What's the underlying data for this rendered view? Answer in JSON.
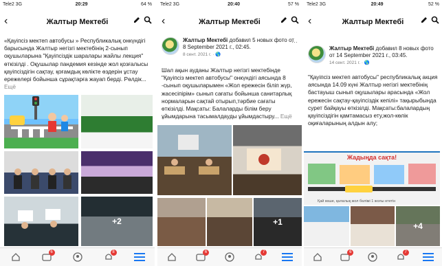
{
  "colors": {
    "accent": "#1877f2",
    "badge": "#e53935",
    "tabbar": "#f7f7f7"
  },
  "screens": [
    {
      "status": {
        "carrier": "Tele2 3G",
        "time": "20:29",
        "battery": "64 %"
      },
      "title": "Жалтыр Мектебі",
      "post_text": "«Қауіпсіз мектеп автобусы » Республикалық онкүндігі барысында Жалтыр негізгі мектебінің 2-сынып оқушыларына \"Қауіпсіздік шаралары жайлы лекция\" өткізілді . Оқушылар пандемия кезінде жол қозғалысы қауіпсіздігін сақтау, қоғамдық көлікте өздерін ұстау ережелері бойынша сұрақтарға жауап берді. Рөлдік...",
      "more": "Ещё",
      "photo_overlay": "+2",
      "tabs": [
        {
          "icon": "home-icon",
          "badge": ""
        },
        {
          "icon": "video-icon",
          "badge": "6"
        },
        {
          "icon": "profile-icon",
          "badge": ""
        },
        {
          "icon": "bell-icon",
          "badge": "8"
        },
        {
          "icon": "menu-icon",
          "badge": ""
        }
      ]
    },
    {
      "status": {
        "carrier": "Tele2 3G",
        "time": "20:40",
        "battery": "57 %"
      },
      "title": "Жалтыр Мектебі",
      "author": "Жалтыр Мектебі",
      "action": "добавил 5 новых фото от 8 September 2021 г., 02:45.",
      "date": "8 сент. 2021 г. · ",
      "post_text": "Шал ақын ауданы Жалтыр негізгі мектебінде \"Қауіпсіз мектеп автобусы\" онкүндігі аясында 8 -сынып оқушыларымен «Жол ережесін біліп жүр, жасесіпірім» сынып сағаты бойынша санитарлық нормаларын сақтай отырып,тәрбие сағаты өткізілді. Мақсаты: Балаларды білім беру ұйымдарына тасымалдауды ұйымдастыру...",
      "more": "Ещё",
      "photo_overlay": "+1",
      "tabs": [
        {
          "icon": "home-icon",
          "badge": ""
        },
        {
          "icon": "video-icon",
          "badge": "6"
        },
        {
          "icon": "profile-icon",
          "badge": ""
        },
        {
          "icon": "bell-icon",
          "badge": "7"
        },
        {
          "icon": "menu-icon",
          "badge": ""
        }
      ]
    },
    {
      "status": {
        "carrier": "Tele2 3G",
        "time": "20:49",
        "battery": "52 %"
      },
      "title": "Жалтыр Мектебі",
      "author": "Жалтыр Мектебі",
      "action": "добавил 8 новых фото от 14 September 2021 г., 03:45.",
      "date": "14 сент. 2021 г. · ",
      "post_text": "\"Қауіпсіз мектеп автобусы\" республикалық акция аясында 14.09 күні Жалтыр негізгі мектебінің бастауыш сынып оқушылары арасында «Жол ережесін сақтау-қауіпсіздік кепілі» тақырыбында сурет байқауы өткізілді. Мақсаты:балалардың қауіпсіздігін қамтамасыз ету,жол-көлік оқиғаларының алдын алу;",
      "poster_title": "Жадыңда сақта!",
      "poster_caption": "Қай көше, қалалық жол бөлімі 1 жолы өтетін",
      "photo_overlay": "+4",
      "tabs": [
        {
          "icon": "home-icon",
          "badge": ""
        },
        {
          "icon": "video-icon",
          "badge": "6"
        },
        {
          "icon": "profile-icon",
          "badge": ""
        },
        {
          "icon": "bell-icon",
          "badge": "7"
        },
        {
          "icon": "menu-icon",
          "badge": ""
        }
      ]
    }
  ]
}
